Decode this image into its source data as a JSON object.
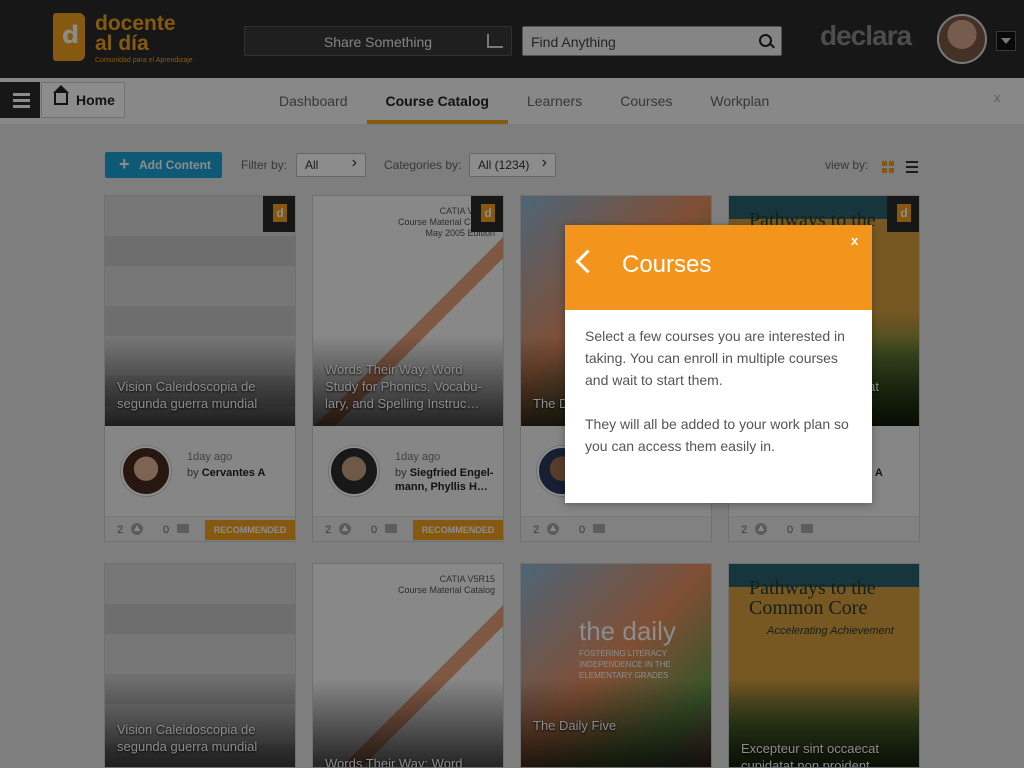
{
  "brand": {
    "name_line1": "docente",
    "name_line2": "al día",
    "tagline": "Comunidad para el Aprendizaje",
    "partner": "declara"
  },
  "header": {
    "share_label": "Share Something",
    "search_placeholder": "Find Anything"
  },
  "nav": {
    "home_label": "Home",
    "tabs": [
      "Dashboard",
      "Course Catalog",
      "Learners",
      "Courses",
      "Workplan"
    ],
    "active_tab": "Course Catalog",
    "close": "x"
  },
  "toolbar": {
    "add_label": "Add Content",
    "filter_label": "Filter by:",
    "filter_value": "All",
    "categories_label": "Categories by:",
    "categories_value": "All (1234)",
    "view_label": "view by:"
  },
  "cards": [
    {
      "title": "Vision Caleidoscopia de segunda guerra mundial",
      "time": "1day ago",
      "by": "by",
      "author": "Cervantes A",
      "upvotes": "2",
      "comments": "0",
      "badge": "RECOMMENDED"
    },
    {
      "cover_head": "CATIA V5R15",
      "cover_sub": "Course Material Catalog",
      "cover_edition": "May 2005 Edition",
      "title": "Words Their Way: Word Study for Phonics, Vocabu-lary, and Spelling Instruc…",
      "time": "1day ago",
      "by": "by",
      "author": "Siegfried Engel-mann, Phyllis H…",
      "upvotes": "2",
      "comments": "0",
      "badge": "RECOMMENDED"
    },
    {
      "title": "The Daily Five",
      "author": "…",
      "upvotes": "2",
      "comments": "0"
    },
    {
      "cover_title": "Pathways to the Common Core",
      "title": "Excepteur sint occaecat cupidatat non proident,",
      "author": "…es A",
      "upvotes": "2",
      "comments": "0"
    }
  ],
  "cards_row2": [
    {
      "title": "Vision Caleidoscopia de segunda guerra mundial"
    },
    {
      "cover_head": "CATIA V5R15",
      "cover_sub": "Course Material Catalog",
      "title": "Words Their Way: Word Study for Phonics, Vocabu-"
    },
    {
      "cover_title": "the daily",
      "cover_sub": "FOSTERING LITERACY INDEPENDENCE IN THE ELEMENTARY GRADES",
      "title": "The Daily Five"
    },
    {
      "cover_title": "Pathways to the Common Core",
      "cover_sub": "Accelerating Achievement",
      "title": "Excepteur sint occaecat cupidatat non proident,"
    }
  ],
  "modal": {
    "title": "Courses",
    "close": "x",
    "paragraph1": "Select a few courses you are interested in taking. You can enroll in multiple courses and wait to start them.",
    "paragraph2": "They will all be added to your work plan so you can access them easily in."
  },
  "colors": {
    "accent": "#f3a31d",
    "modal_header": "#f3941d",
    "add_button": "#1aa3d8",
    "topbar": "#2b2b2b"
  },
  "icons": [
    "menu-icon",
    "home-icon",
    "share-icon",
    "search-icon",
    "grid-view-icon",
    "list-view-icon",
    "upvote-icon",
    "comment-icon",
    "back-icon",
    "close-icon"
  ]
}
